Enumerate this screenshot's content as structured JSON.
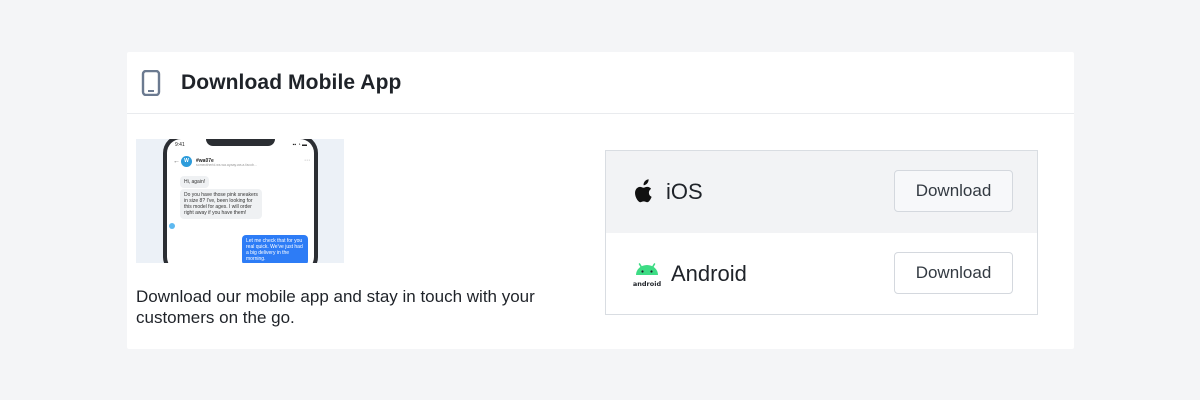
{
  "card": {
    "title": "Download Mobile App",
    "header_icon": "mobile-phone-icon"
  },
  "preview": {
    "status_time": "9:41",
    "status_icons": "▪▪ ◔ ▬",
    "contact_name": "#wa07e",
    "contact_avatar": "W",
    "contact_sub": "someotherid.ws.wa.ayaay.wa.a.facob...",
    "messages": [
      {
        "dir": "in",
        "text": "Hi, again!"
      },
      {
        "dir": "in",
        "text": "Do you have those pink sneakers in size 8? I've, been looking for this model for ages. I will order right away if you have them!"
      },
      {
        "dir": "out",
        "text": "Let me check that for you real quick. We've just had a big delivery in the morning."
      }
    ]
  },
  "description": "Download our mobile app and stay in touch with your customers on the go.",
  "platforms": [
    {
      "name": "iOS",
      "icon": "apple-icon",
      "button_label": "Download"
    },
    {
      "name": "Android",
      "icon": "android-icon",
      "button_label": "Download",
      "icon_caption": "android"
    }
  ],
  "colors": {
    "page_bg": "#f4f5f7",
    "card_bg": "#ffffff",
    "ios_row_bg": "#f2f3f5",
    "android_green": "#3ddc84",
    "header_icon_color": "#6b7a90",
    "chat_out_bubble": "#2d7cf6"
  }
}
